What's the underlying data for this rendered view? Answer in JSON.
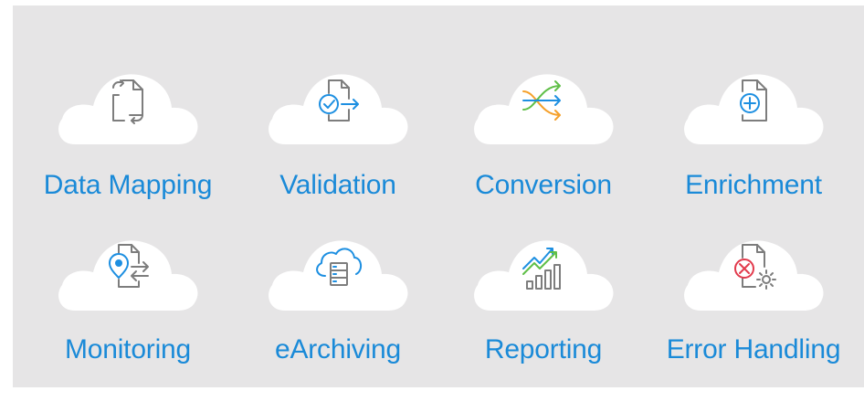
{
  "colors": {
    "panel": "#e6e5e6",
    "cloud": "#ffffff",
    "label": "#1a8ad8",
    "icon_gray": "#7d7d7d",
    "icon_blue": "#1d8fe1",
    "icon_green": "#5fbf47",
    "icon_orange": "#f5a02a",
    "icon_red": "#e23a4c"
  },
  "features": [
    {
      "label": "Data Mapping",
      "icon": "document-swap-icon"
    },
    {
      "label": "Validation",
      "icon": "document-check-icon"
    },
    {
      "label": "Conversion",
      "icon": "shuffle-arrows-icon"
    },
    {
      "label": "Enrichment",
      "icon": "document-add-icon"
    },
    {
      "label": "Monitoring",
      "icon": "document-location-icon"
    },
    {
      "label": "eArchiving",
      "icon": "cloud-server-icon"
    },
    {
      "label": "Reporting",
      "icon": "bar-chart-trend-icon"
    },
    {
      "label": "Error Handling",
      "icon": "document-error-gear-icon"
    }
  ]
}
